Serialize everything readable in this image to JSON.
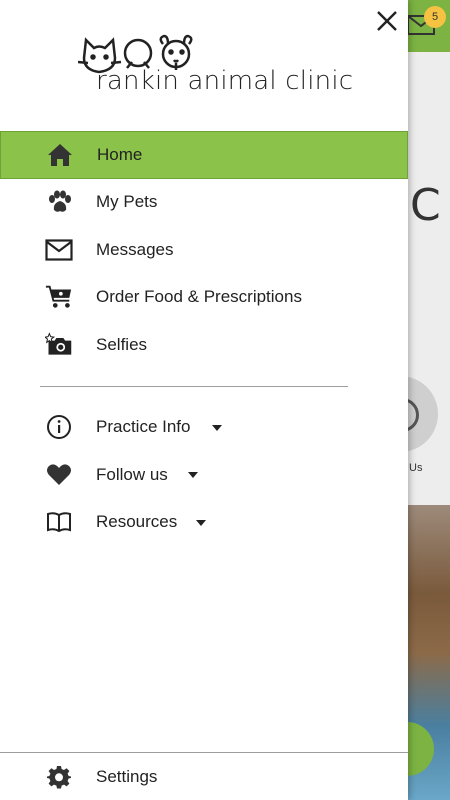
{
  "app": {
    "name": "rankin animal clinic"
  },
  "background": {
    "badge_count": "5",
    "partial_letter": "C",
    "partial_label": "Us"
  },
  "drawer": {
    "close_label": "×",
    "items": [
      {
        "label": "Home",
        "icon": "home-icon",
        "active": true
      },
      {
        "label": "My Pets",
        "icon": "paw-icon"
      },
      {
        "label": "Messages",
        "icon": "mail-icon"
      },
      {
        "label": "Order Food & Prescriptions",
        "icon": "cart-icon"
      },
      {
        "label": "Selfies",
        "icon": "camera-icon"
      }
    ],
    "secondary": [
      {
        "label": "Practice Info",
        "icon": "info-icon"
      },
      {
        "label": "Follow us",
        "icon": "heart-icon"
      },
      {
        "label": "Resources",
        "icon": "book-icon"
      }
    ],
    "footer": {
      "label": "Settings",
      "icon": "gear-icon"
    }
  },
  "colors": {
    "accent": "#8bc34a",
    "text": "#222222"
  }
}
